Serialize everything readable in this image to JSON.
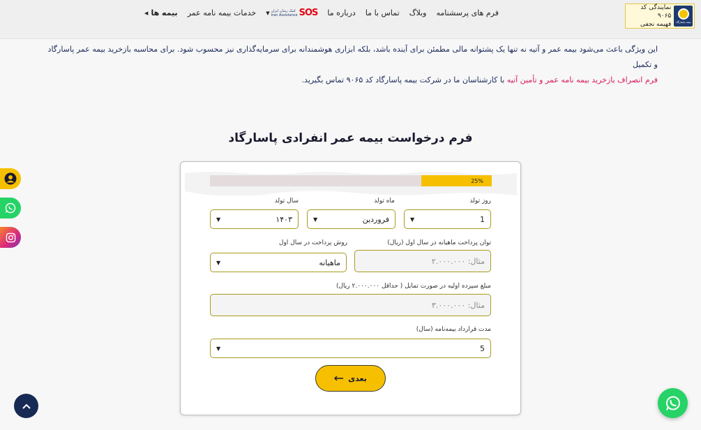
{
  "header": {
    "logo_line1": "نمایندگی کد ۹۰۶۵",
    "logo_line2": "فهیمه نجفی",
    "logo_brand": "بیمه پاسارگاد",
    "nav": [
      {
        "label": "بیمه ها",
        "has_caret": true
      },
      {
        "label": "خدمات بیمه نامه عمر",
        "has_caret": false
      },
      {
        "label": "SOS",
        "has_caret": true
      },
      {
        "label": "درباره ما",
        "has_caret": false
      },
      {
        "label": "تماس با ما",
        "has_caret": false
      },
      {
        "label": "وبلاگ",
        "has_caret": false
      },
      {
        "label": "فرم های پرسشنامه",
        "has_caret": false
      }
    ],
    "sos_sub1": "کمک رسان ایران",
    "sos_sub2": "Iran Assistance"
  },
  "intro": {
    "line1": "این ویژگی باعث می‌شود بیمه عمر و آتیه نه تنها یک پشتوانه مالی مطمئن برای آینده باشد، بلکه ابزاری هوشمندانه برای سرمایه‌گذاری نیز محسوب شود. برای  محاسبه بازخرید بیمه عمر پاسارگاد و تکمیل",
    "link": "فرم انصراف بازخرید بیمه نامه عمر و تأمین آتیه",
    "line2": " با کارشناسان ما در شرکت بیمه پاسارگاد کد ۹۰۶۵ تماس بگیرید."
  },
  "form": {
    "title": "فرم درخواست بیمه عمر انفرادی پاسارگاد",
    "progress_label": "25%",
    "progress_fraction": 0.25,
    "birth_day_label": "روز تولد",
    "birth_day_value": "1",
    "birth_month_label": "ماه تولد",
    "birth_month_value": "فروردین",
    "birth_year_label": "سال تولد",
    "birth_year_value": "۱۴۰۳",
    "monthly_capacity_label": "توان پرداخت ماهیانه در سال اول (ریال)",
    "monthly_capacity_placeholder": "مثال: ۲.۰۰۰.۰۰۰",
    "payment_method_label": "روش پرداخت در سال اول",
    "payment_method_value": "ماهیانه",
    "initial_deposit_label": "مبلغ سپرده اولیه در صورت تمایل ( حداقل ۲.۰۰۰.۰۰۰ ریال)",
    "initial_deposit_placeholder": "مثال: ۳.۰۰۰.۰۰۰",
    "duration_label": "مدت قرارداد بیمه‌نامه (سال)",
    "duration_value": "5",
    "next_label": "بعدی"
  },
  "colors": {
    "accent": "#f6c000",
    "navy": "#172a54",
    "whatsapp": "#25d366",
    "link": "#d81b60",
    "field_border": "#a89a1f"
  },
  "icons": [
    "user-icon",
    "whatsapp-icon",
    "instagram-icon",
    "chevron-up-icon",
    "arrow-left-icon",
    "caret-down-icon"
  ]
}
